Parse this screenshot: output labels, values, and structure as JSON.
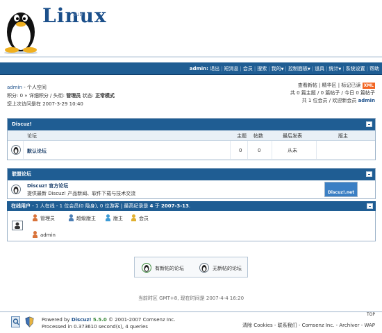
{
  "header": {
    "brand": "Linux",
    "brand_sup": "sub"
  },
  "nav": {
    "items": [
      "admin:",
      "退出",
      "短消息",
      "会员",
      "搜索",
      "我的",
      "控制面板",
      "道具",
      "统计",
      "系统设置",
      "帮助"
    ]
  },
  "userinfo": {
    "username": "admin",
    "space_link": "- 个人空间",
    "credits_label": "积分:",
    "credits_value": "0",
    "credits_detail": "详细积分",
    "title_label": "头衔:",
    "title_value": "管理员",
    "status_label": "状态:",
    "status_value": "正常模式",
    "last_visit": "您上次访问是在 2007-3-29 10:40",
    "links": [
      "查看新帖",
      "精华区",
      "标记已读"
    ],
    "xml_badge": "XML",
    "stats_line1": "共 0 篇主题 / 0 篇帖子 / 今日 0 篇帖子",
    "stats_line2_prefix": "共 1 位会员 / 欢迎新会员",
    "stats_line2_user": "admin"
  },
  "forum_panel": {
    "title": "Discuz!",
    "columns": [
      "论坛",
      "主题",
      "帖数",
      "最后发表",
      "版主"
    ],
    "rows": [
      {
        "name": "默认论坛",
        "topics": "0",
        "posts": "0",
        "last_post": "从未",
        "moderator": ""
      }
    ]
  },
  "union_panel": {
    "title": "联盟论坛",
    "name": "Discuz! 官方论坛",
    "desc": "提供最新 Discuz! 产品新闻、软件下载与技术交流",
    "logo_text": "Discuz!.net"
  },
  "online": {
    "head_label": "在线用户",
    "head_stats": "- 1 人在线 - 1 位会员(0 隐身), 0 位游客 | 最高纪录是",
    "record_count": "4",
    "record_mid": "于",
    "record_date": "2007-3-13",
    "legend": [
      {
        "label": "管理员",
        "color": "#d9733a"
      },
      {
        "label": "超级版主",
        "color": "#4d7fb5"
      },
      {
        "label": "版主",
        "color": "#3d9bd6"
      },
      {
        "label": "会员",
        "color": "#e0b030"
      }
    ],
    "user": "admin",
    "user_color": "#d9733a"
  },
  "post_legend": {
    "new_posts": "有新帖的论坛",
    "no_new_posts": "无新帖的论坛"
  },
  "time_line": "当前时区 GMT+8, 现在时间是 2007-4-4 16:20",
  "footer": {
    "powered_prefix": "Powered by",
    "powered_name": "Discuz!",
    "version": "5.5.0",
    "copyright": "© 2001-2007 Comsenz Inc.",
    "processed": "Processed in 0.373610 second(s), 4 queries",
    "right_text": "清除 Cookies - 联系我们 - Comsenz Inc. - Archiver - WAP",
    "top": "TOP"
  }
}
